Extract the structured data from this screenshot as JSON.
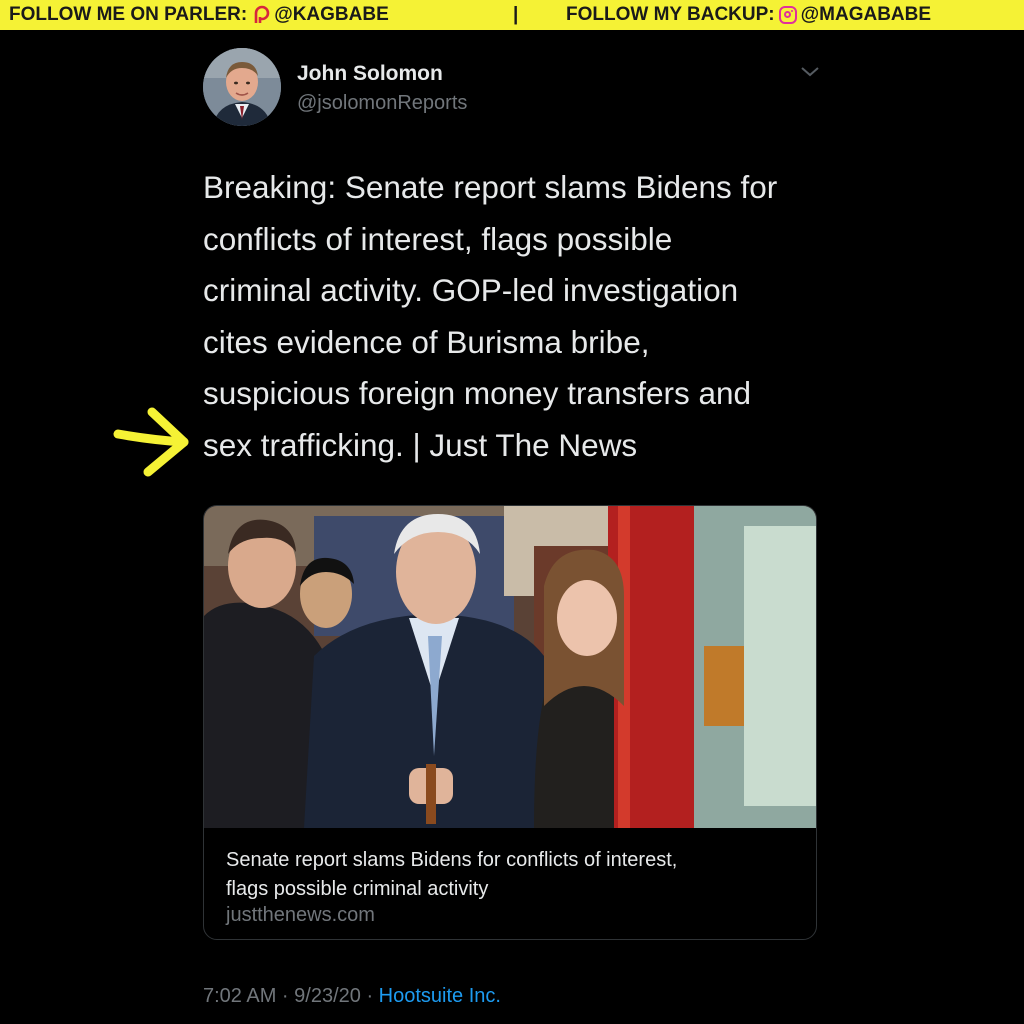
{
  "banner": {
    "left_text": "FOLLOW ME ON PARLER:",
    "left_handle": "@KAGBABE",
    "separator": "|",
    "right_text": "FOLLOW MY BACKUP:",
    "right_handle": "@MAGABABE",
    "left_icon": "parler-logo-icon",
    "right_icon": "instagram-logo-icon",
    "background": "#f5f235"
  },
  "tweet": {
    "author_name": "John Solomon",
    "author_handle": "@jsolomonReports",
    "text_lines": [
      "Breaking: Senate report slams Bidens for",
      "conflicts of interest, flags possible",
      "criminal activity. GOP-led investigation",
      "cites evidence of Burisma bribe,",
      "suspicious foreign money transfers and",
      "sex trafficking. | Just The News"
    ],
    "card": {
      "title_line1": "Senate report slams Bidens for conflicts of interest,",
      "title_line2": "flags possible criminal activity",
      "domain": "justthenews.com"
    },
    "timestamp": "7:02 AM · 9/23/20 · ",
    "source": "Hootsuite Inc."
  },
  "colors": {
    "background": "#000000",
    "text": "#e7e9ea",
    "muted": "#71767b",
    "link": "#1d9bf0",
    "annotation_arrow": "#f5f235"
  },
  "icons": {
    "menu": "chevron-down-icon",
    "annotation": "yellow-arrow-icon"
  }
}
